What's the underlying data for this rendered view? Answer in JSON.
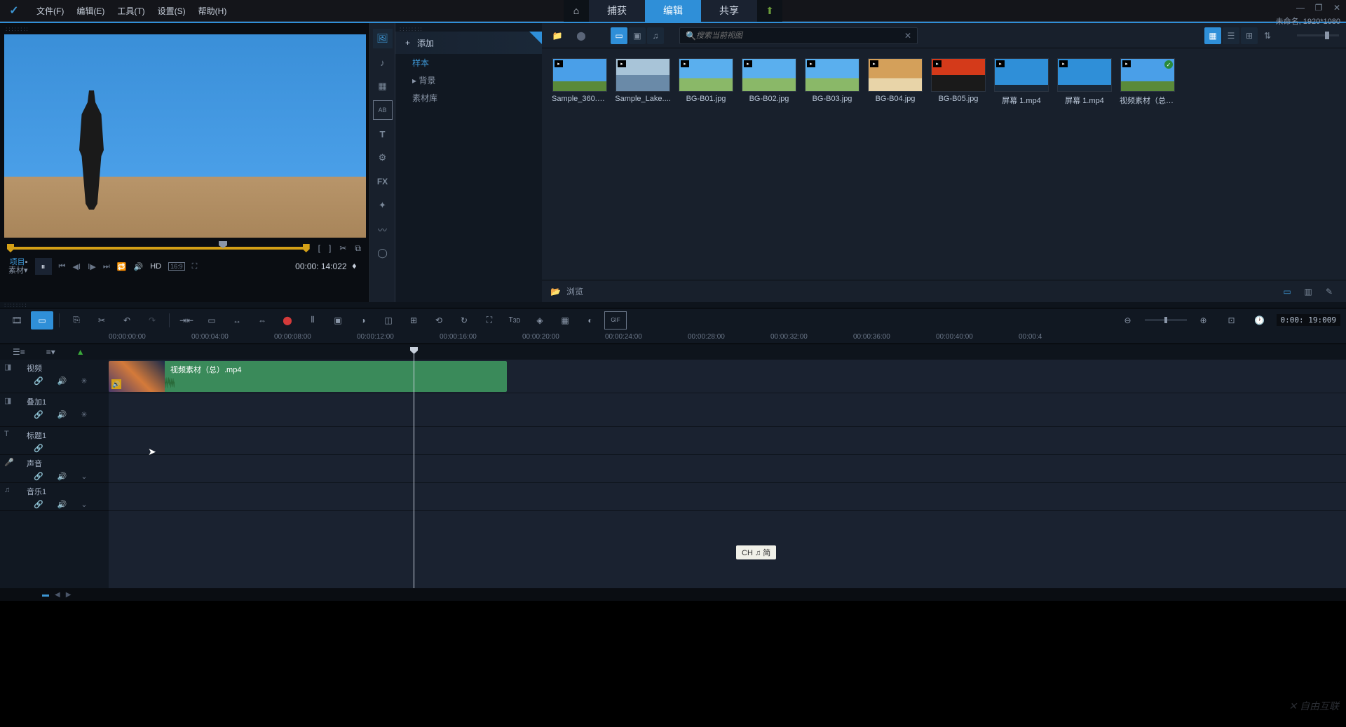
{
  "menu": {
    "file": "文件(F)",
    "edit": "编辑(E)",
    "tools": "工具(T)",
    "settings": "设置(S)",
    "help": "帮助(H)"
  },
  "topbar": {
    "capture": "捕获",
    "edit": "编辑",
    "share": "共享"
  },
  "project_info": "未命名, 1920*1080",
  "preview": {
    "proj_label_top": "项目",
    "proj_label_bottom": "素材",
    "hd": "HD",
    "ratio": "16:9",
    "timecode": "00:00: 14:022"
  },
  "library": {
    "add": "添加",
    "tree": {
      "sample": "样本",
      "background": "背景",
      "assets": "素材库"
    },
    "browse": "浏览"
  },
  "search_placeholder": "搜索当前视图",
  "media": [
    {
      "name": "Sample_360.m...",
      "cls": "photo"
    },
    {
      "name": "Sample_Lake....",
      "cls": "lake"
    },
    {
      "name": "BG-B01.jpg",
      "cls": "sky"
    },
    {
      "name": "BG-B02.jpg",
      "cls": "sky"
    },
    {
      "name": "BG-B03.jpg",
      "cls": "sky"
    },
    {
      "name": "BG-B04.jpg",
      "cls": "desert"
    },
    {
      "name": "BG-B05.jpg",
      "cls": "sunset"
    },
    {
      "name": "屏幕 1.mp4",
      "cls": "desktop"
    },
    {
      "name": "屏幕 1.mp4",
      "cls": "desktop"
    },
    {
      "name": "视频素材（总）....",
      "cls": "photo",
      "checked": true
    }
  ],
  "timeline": {
    "timecode": "0:00: 19:009",
    "ruler": [
      "00:00:00:00",
      "00:00:04:00",
      "00:00:08:00",
      "00:00:12:00",
      "00:00:16:00",
      "00:00:20:00",
      "00:00:24:00",
      "00:00:28:00",
      "00:00:32:00",
      "00:00:36:00",
      "00:00:40:00",
      "00:00:4"
    ],
    "tracks": {
      "video": "视频",
      "overlay": "叠加1",
      "title": "标题1",
      "voice": "声音",
      "music": "音乐1"
    },
    "clip_label": "视频素材（总）.mp4"
  },
  "ime": "CH ♫ 简",
  "watermark": "自由互联"
}
